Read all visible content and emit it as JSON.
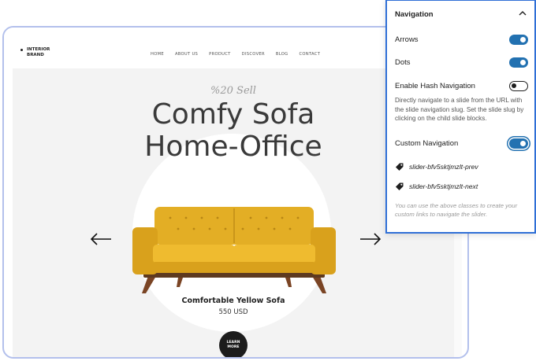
{
  "site": {
    "logo_line1": "INTERIOR",
    "logo_line2": "BRAND",
    "nav": [
      "HOME",
      "ABOUT US",
      "PRODUCT",
      "DISCOVER",
      "BLOG",
      "CONTACT"
    ]
  },
  "slide": {
    "sell": "%20 Sell",
    "title_line1": "Comfy Sofa",
    "title_line2": "Home-Office",
    "product_name": "Comfortable Yellow Sofa",
    "price": "550 USD",
    "cta": "LEARN\nMORE"
  },
  "panel": {
    "title": "Navigation",
    "arrows_label": "Arrows",
    "arrows_on": true,
    "dots_label": "Dots",
    "dots_on": true,
    "hash_label": "Enable Hash Navigation",
    "hash_on": false,
    "hash_help": "Directly navigate to a slide from the URL with the slide navigation slug. Set the slide slug by clicking on the child slide blocks.",
    "custom_label": "Custom Navigation",
    "custom_on": true,
    "class_prev": "slider-bfv5sktjmzlt-prev",
    "class_next": "slider-bfv5sktjmzlt-next",
    "custom_help": "You can use the above classes to create your custom links to navigate the slider."
  },
  "colors": {
    "accent": "#2271b1",
    "panel_border": "#2f6fd6",
    "frame_border": "#b3c0ec",
    "sofa": "#e3ae25"
  }
}
